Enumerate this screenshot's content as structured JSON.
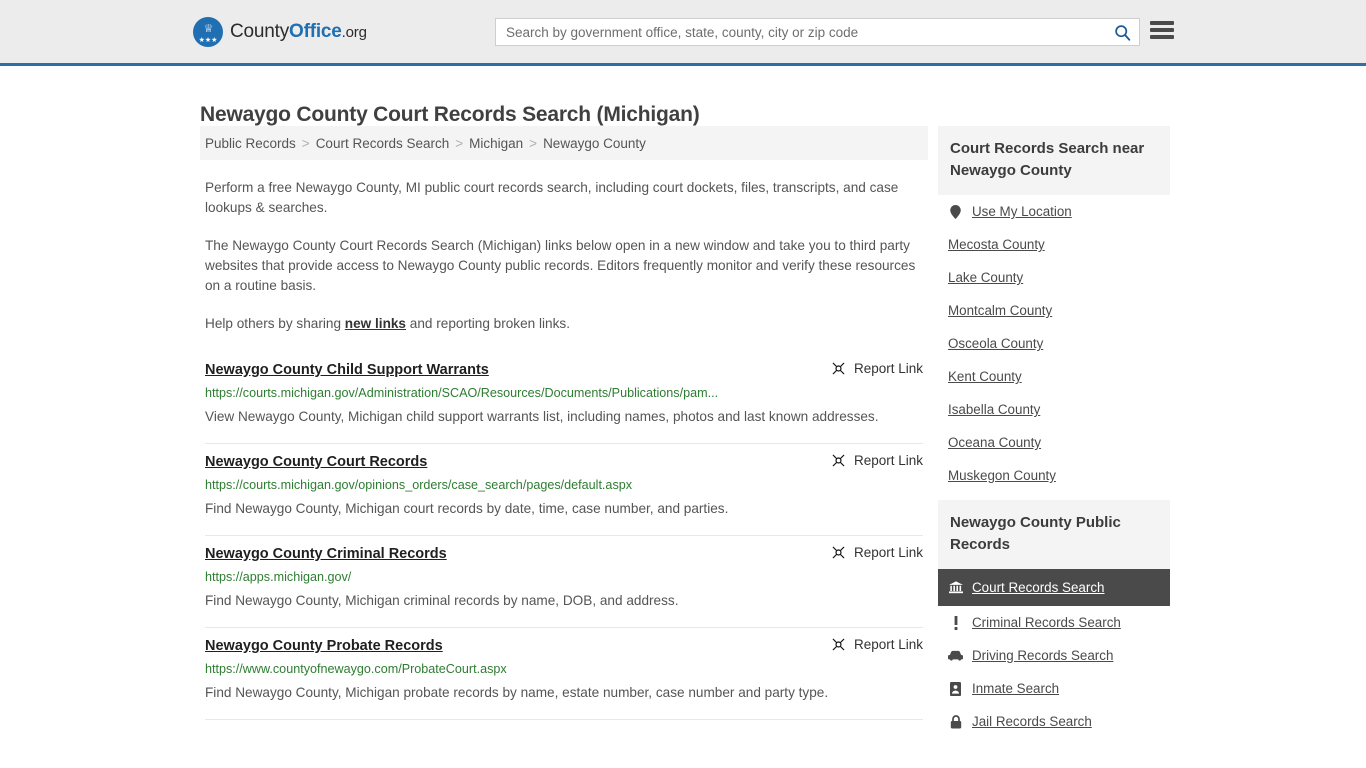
{
  "header": {
    "logo": {
      "part1": "County",
      "part2": "Office",
      "part3": ".org"
    },
    "search": {
      "placeholder": "Search by government office, state, county, city or zip code",
      "value": "",
      "button_icon": "search-icon"
    },
    "menu_icon": "hamburger-menu-icon"
  },
  "page": {
    "title": "Newaygo County Court Records Search (Michigan)"
  },
  "breadcrumb": {
    "items": [
      {
        "label": "Public Records",
        "current": false
      },
      {
        "label": "Court Records Search",
        "current": false
      },
      {
        "label": "Michigan",
        "current": false
      },
      {
        "label": "Newaygo County",
        "current": true
      }
    ],
    "separator": ">"
  },
  "intro": {
    "paragraph1": "Perform a free Newaygo County, MI public court records search, including court dockets, files, transcripts, and case lookups & searches.",
    "paragraph2": "The Newaygo County Court Records Search (Michigan) links below open in a new window and take you to third party websites that provide access to Newaygo County public records. Editors frequently monitor and verify these resources on a routine basis.",
    "paragraph3_before": "Help others by sharing ",
    "paragraph3_link": "new links",
    "paragraph3_after": " and reporting broken links."
  },
  "report_link_label": "Report Link",
  "results": [
    {
      "title": "Newaygo County Child Support Warrants",
      "url": "https://courts.michigan.gov/Administration/SCAO/Resources/Documents/Publications/pam...",
      "description": "View Newaygo County, Michigan child support warrants list, including names, photos and last known addresses."
    },
    {
      "title": "Newaygo County Court Records",
      "url": "https://courts.michigan.gov/opinions_orders/case_search/pages/default.aspx",
      "description": "Find Newaygo County, Michigan court records by date, time, case number, and parties."
    },
    {
      "title": "Newaygo County Criminal Records",
      "url": "https://apps.michigan.gov/",
      "description": "Find Newaygo County, Michigan criminal records by name, DOB, and address."
    },
    {
      "title": "Newaygo County Probate Records",
      "url": "https://www.countyofnewaygo.com/ProbateCourt.aspx",
      "description": "Find Newaygo County, Michigan probate records by name, estate number, case number and party type."
    }
  ],
  "sidebar": {
    "nearby": {
      "header": "Court Records Search near Newaygo County",
      "items": [
        {
          "label": "Use My Location",
          "icon": "map-pin-icon"
        },
        {
          "label": "Mecosta County",
          "icon": ""
        },
        {
          "label": "Lake County",
          "icon": ""
        },
        {
          "label": "Montcalm County",
          "icon": ""
        },
        {
          "label": "Osceola County",
          "icon": ""
        },
        {
          "label": "Kent County",
          "icon": ""
        },
        {
          "label": "Isabella County",
          "icon": ""
        },
        {
          "label": "Oceana County",
          "icon": ""
        },
        {
          "label": "Muskegon County",
          "icon": ""
        }
      ]
    },
    "public_records": {
      "header": "Newaygo County Public Records",
      "items": [
        {
          "label": "Court Records Search",
          "icon": "courthouse-icon",
          "active": true
        },
        {
          "label": "Criminal Records Search",
          "icon": "exclamation-icon",
          "active": false
        },
        {
          "label": "Driving Records Search",
          "icon": "car-icon",
          "active": false
        },
        {
          "label": "Inmate Search",
          "icon": "id-card-icon",
          "active": false
        },
        {
          "label": "Jail Records Search",
          "icon": "lock-icon",
          "active": false
        }
      ]
    }
  },
  "colors": {
    "header_bg": "#ececec",
    "header_border": "#2f6fa8",
    "brand_blue": "#1f6fb2",
    "url_green": "#2e7d32",
    "active_bg": "#4a4a4a",
    "panel_bg": "#f4f4f4"
  }
}
